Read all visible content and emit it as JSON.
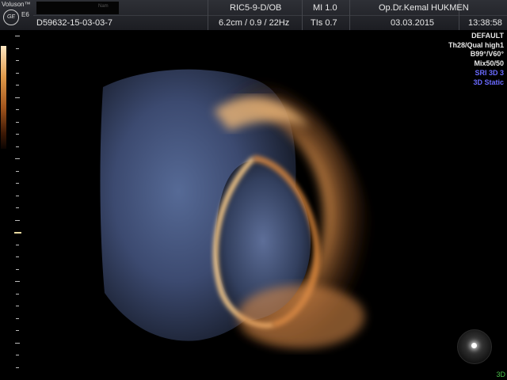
{
  "header": {
    "brand": "Voluson™",
    "logo_text": "GE",
    "model": "E6",
    "redacted_text": "Nam",
    "patient_id": "D59632-15-03-03-7",
    "probe_program": "RIC5-9-D/OB",
    "mi": "MI  1.0",
    "depth_info": "6.2cm / 0.9 / 22Hz",
    "tis": "TIs  0.7",
    "operator": "Op.Dr.Kemal HUKMEN",
    "date": "03.03.2015",
    "time": "13:38:58"
  },
  "params": {
    "items": [
      {
        "text": "DEFAULT",
        "color": "#e8e8e8"
      },
      {
        "text": "Th28/Qual high1",
        "color": "#e8e8e8"
      },
      {
        "text": "B99°/V60°",
        "color": "#e8e8e8"
      },
      {
        "text": "Mix50/50",
        "color": "#e8e8e8"
      },
      {
        "text": "SRI 3D 3",
        "color": "#6a6aff"
      },
      {
        "text": "3D Static",
        "color": "#6a6aff"
      }
    ]
  },
  "mode_badge": "3D",
  "colors": {
    "header_bg": "#26282d",
    "accent_blue": "#6a6aff",
    "render_amber": "#e49850",
    "render_blue": "#4a5884"
  }
}
